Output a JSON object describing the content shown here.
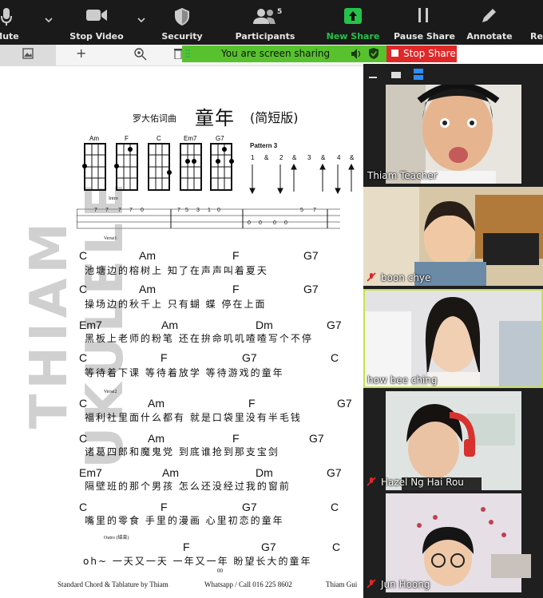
{
  "toolbar": {
    "items": [
      {
        "label": "Mute",
        "icon": "microphone-icon"
      },
      {
        "label": "Stop Video",
        "icon": "video-camera-icon"
      },
      {
        "label": "Security",
        "icon": "shield-icon"
      },
      {
        "label": "Participants",
        "icon": "participants-icon",
        "count": "5"
      },
      {
        "label": "New Share",
        "icon": "share-screen-icon"
      },
      {
        "label": "Pause Share",
        "icon": "pause-icon"
      },
      {
        "label": "Annotate",
        "icon": "pencil-icon"
      },
      {
        "label": "Re"
      }
    ]
  },
  "share_banner": {
    "text": "You are screen sharing",
    "stop_label": "Stop Share"
  },
  "sheet": {
    "watermark": "THIAM UKULELE",
    "credit": "罗大佑词曲",
    "song_title": "童年",
    "version": "(简短版)",
    "chords": [
      "Am",
      "F",
      "C",
      "Em7",
      "G7"
    ],
    "pattern_label": "Pattern 3",
    "pattern_counts": [
      "1",
      "&",
      "2",
      "&",
      "3",
      "&",
      "4",
      "&"
    ],
    "intro_label": "Intro",
    "verse1_label": "Verse1",
    "verse2_label": "Verse2",
    "outro_label": "Outro (结束)",
    "lines": [
      {
        "chords": [
          "C",
          "Am",
          "F",
          "G7"
        ],
        "lyric": "池塘边的榕树上  知了在声声叫着夏天"
      },
      {
        "chords": [
          "C",
          "Am",
          "F",
          "G7"
        ],
        "lyric": "操场边的秋千上  只有蝴 蝶 停在上面"
      },
      {
        "chords": [
          "Em7",
          "Am",
          "Dm",
          "G7"
        ],
        "lyric": "黑板上老师的粉笔  还在拚命叽叽喳喳写个不停"
      },
      {
        "chords": [
          "C",
          "F",
          "G7",
          "C"
        ],
        "lyric": "等待着下课  等待着放学  等待游戏的童年"
      },
      {
        "chords": [
          "C",
          "Am",
          "F",
          "G7"
        ],
        "lyric": "福利社里面什么都有  就是口袋里没有半毛钱"
      },
      {
        "chords": [
          "C",
          "Am",
          "F",
          "G7"
        ],
        "lyric": "诸葛四郎和魔鬼党  到底谁抢到那支宝剑"
      },
      {
        "chords": [
          "Em7",
          "Am",
          "Dm",
          "G7"
        ],
        "lyric": "隔壁班的那个男孩  怎么还没经过我的窗前"
      },
      {
        "chords": [
          "C",
          "F",
          "G7",
          "C"
        ],
        "lyric": "嘴里的零食  手里的漫画  心里初恋的童年"
      },
      {
        "chords": [
          "F",
          "G7",
          "C"
        ],
        "lyric": "oh~  一天又一天  一年又一年  盼望长大的童年"
      }
    ],
    "footer_left": "Standard Chord & Tablature by Thiam",
    "footer_mid": "Whatsapp / Call 016 225 8602",
    "footer_right": "Thiam Gui",
    "page_marker": "00"
  },
  "participants": [
    {
      "name": "Thiam Teacher",
      "muted": false
    },
    {
      "name": "boon chye",
      "muted": true
    },
    {
      "name": "how bee ching",
      "muted": false,
      "active": true
    },
    {
      "name": "Hazel Ng Hai Rou",
      "muted": true
    },
    {
      "name": "Jun Hoong",
      "muted": true
    }
  ],
  "colors": {
    "share_green": "#57c22e",
    "stop_red": "#e02828",
    "new_share_green": "#26c24a",
    "active_speaker": "#c7e04c"
  }
}
